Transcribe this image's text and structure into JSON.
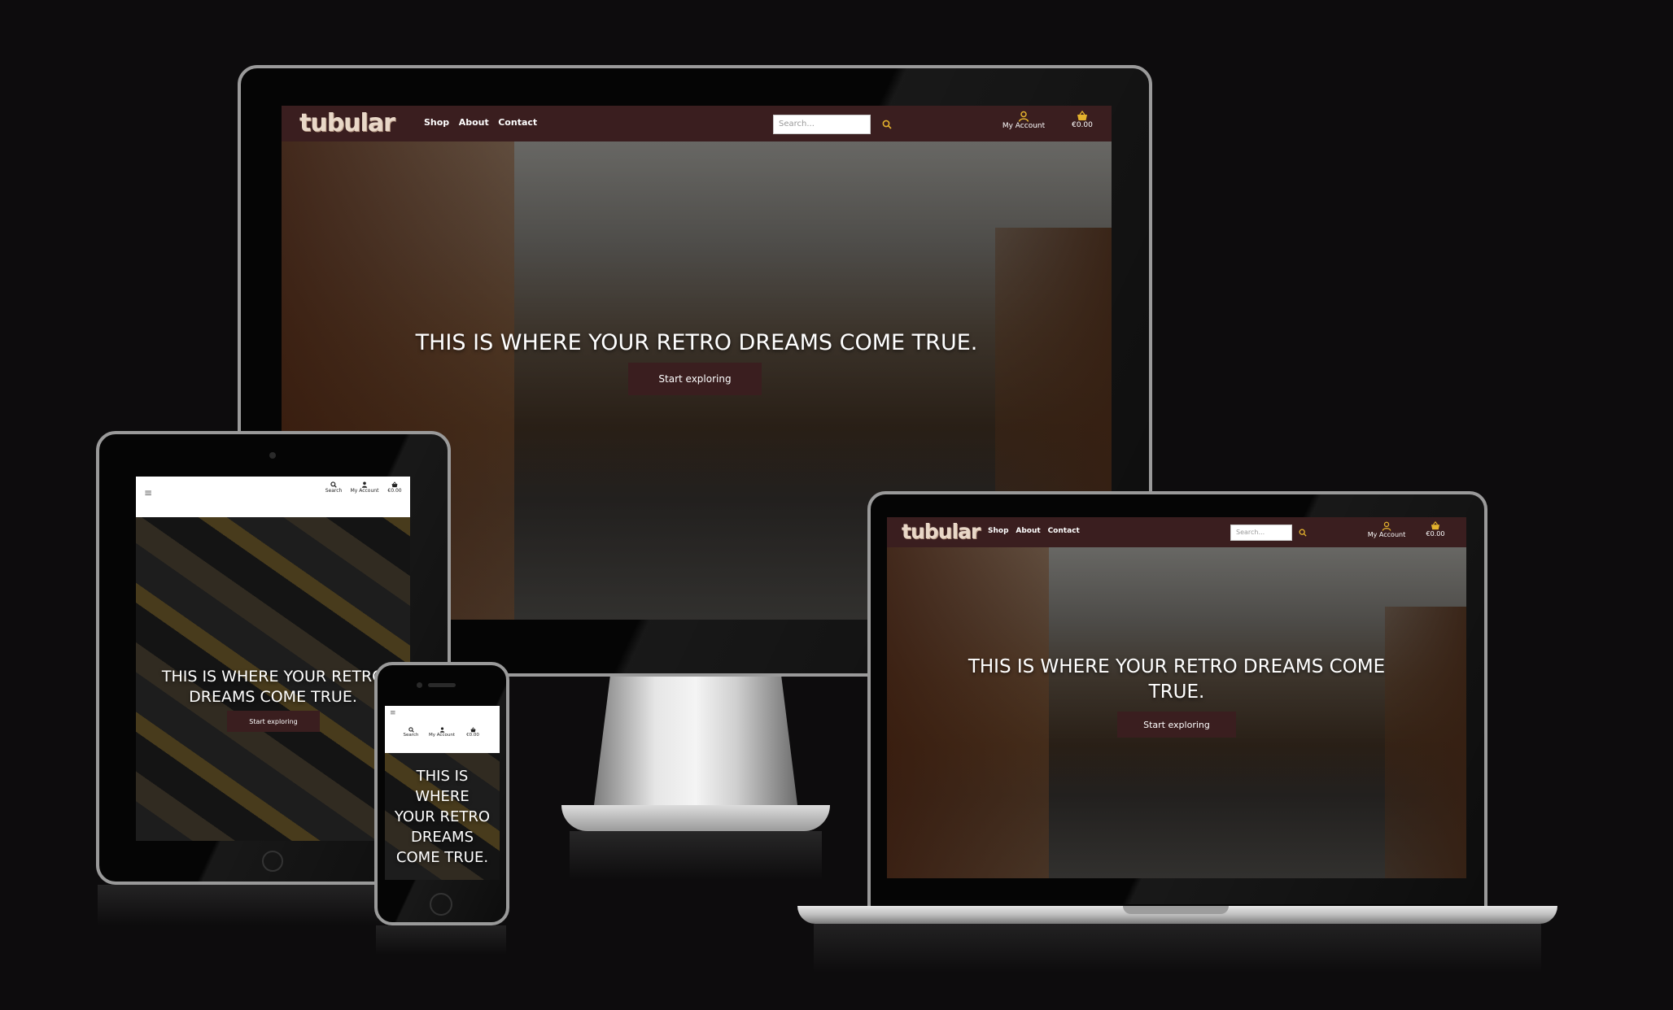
{
  "site": {
    "logo": "tubular",
    "nav_links": [
      "Shop",
      "About",
      "Contact"
    ],
    "search_placeholder": "Search...",
    "account_label": "My Account",
    "search_label": "Search",
    "cart_total": "€0.00",
    "menu_glyph": "≡",
    "hero_heading": "THIS IS WHERE YOUR RETRO DREAMS COME TRUE.",
    "hero_heading_laptop_line1": "THIS IS WHERE YOUR RETRO DREAMS COME",
    "hero_heading_laptop_line2": "TRUE.",
    "hero_heading_tablet_line1": "THIS IS WHERE YOUR RETRO",
    "hero_heading_tablet_line2": "DREAMS COME TRUE.",
    "hero_heading_phone_lines": [
      "THIS IS",
      "WHERE",
      "YOUR RETRO",
      "DREAMS",
      "COME TRUE."
    ],
    "cta_label": "Start exploring"
  },
  "colors": {
    "nav_dark": "#3a1e1f",
    "accent": "#e4b22d",
    "background": "#0d0c0d"
  },
  "icons": {
    "search": "search-icon",
    "account": "user-icon",
    "cart": "basket-icon",
    "menu": "hamburger-icon"
  }
}
